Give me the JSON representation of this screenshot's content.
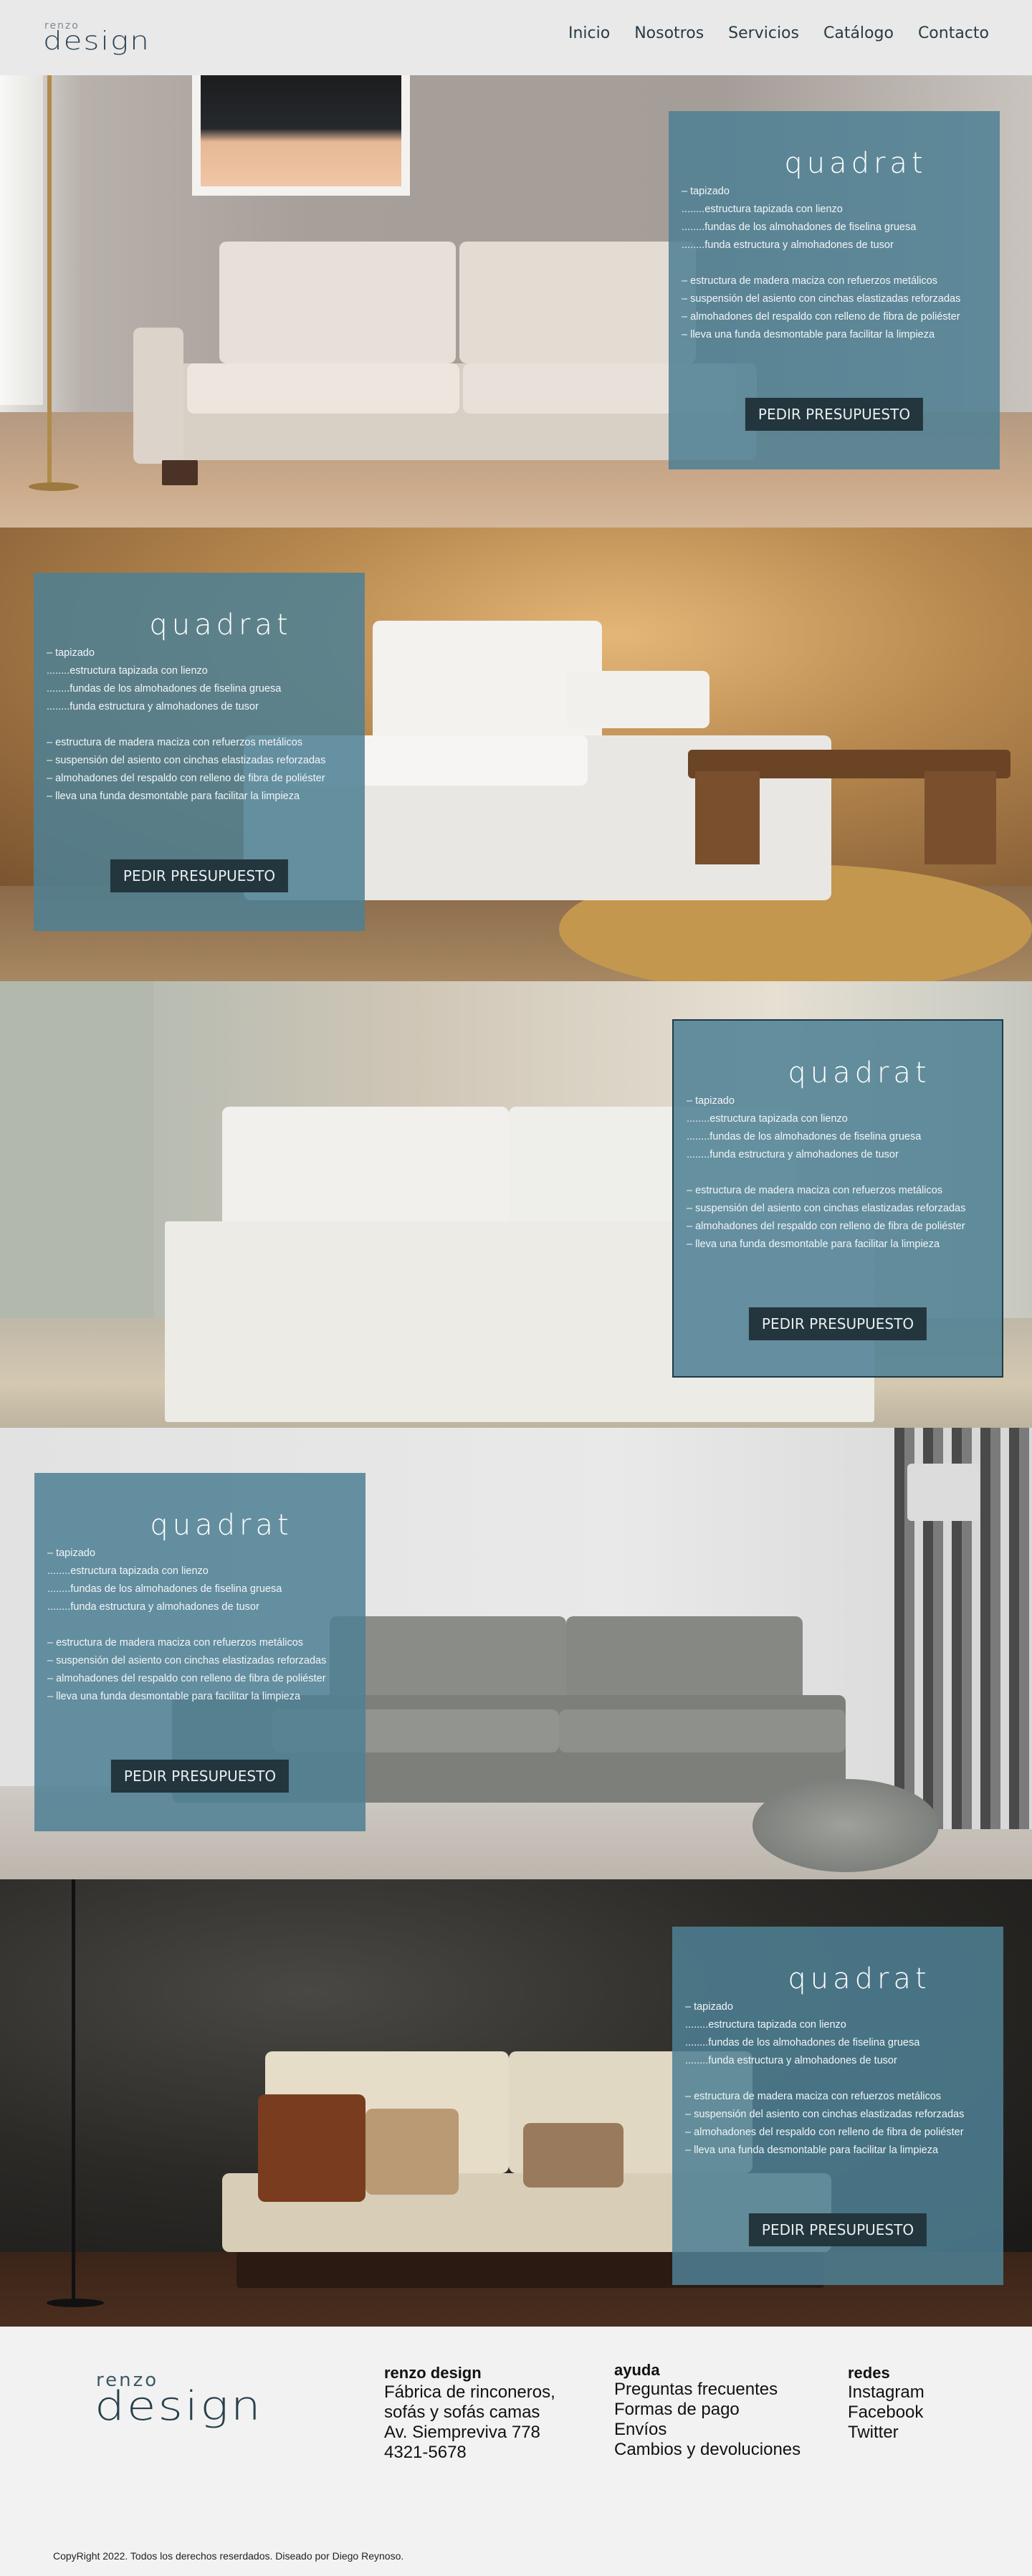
{
  "brand": {
    "logo_small": "renzo",
    "logo_big": "design"
  },
  "nav": {
    "items": [
      "Inicio",
      "Nosotros",
      "Servicios",
      "Catálogo",
      "Contacto"
    ]
  },
  "product_card": {
    "title": "quadrat",
    "features_a": [
      "– tapizado",
      "........estructura tapizada con lienzo",
      "........fundas de los almohadones de fiselina gruesa",
      "........funda estructura y almohadones de tusor"
    ],
    "features_b": [
      "– estructura de madera maciza con refuerzos metálicos",
      "– suspensión del asiento con cinchas elastizadas reforzadas",
      "– almohadones del respaldo con relleno de fibra de poliéster",
      "– lleva una funda desmontable para facilitar la limpieza"
    ],
    "button": "PEDIR PRESUPUESTO"
  },
  "footer": {
    "col1": {
      "title": "renzo design",
      "lines": [
        "Fábrica de rinconeros,",
        "sofás y sofás camas",
        "Av. Siempreviva 778",
        "4321-5678"
      ]
    },
    "col2": {
      "title": "ayuda",
      "links": [
        "Preguntas frecuentes",
        "Formas de pago",
        "Envíos",
        "Cambios y devoluciones"
      ]
    },
    "col3": {
      "title": "redes",
      "links": [
        "Instagram",
        "Facebook",
        "Twitter"
      ]
    },
    "copyright": "CopyRight 2022. Todos los derechos reserdados. Diseado por Diego Reynoso."
  },
  "colors": {
    "card": "#4e8094",
    "button": "#23353d",
    "brand": "#2d4654"
  }
}
